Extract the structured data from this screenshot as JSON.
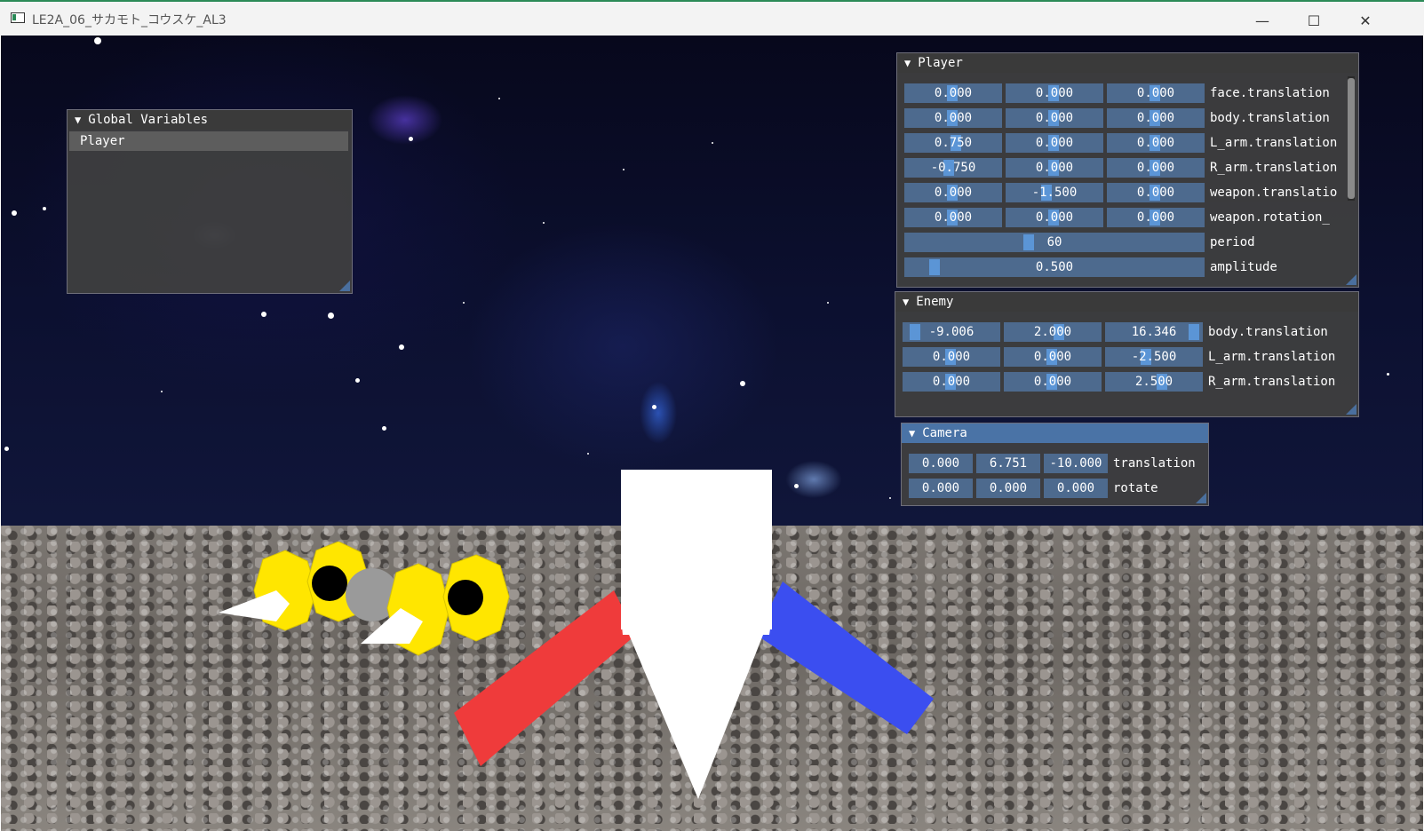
{
  "window": {
    "title": "LE2A_06_サカモト_コウスケ_AL3",
    "min_glyph": "—",
    "max_glyph": "☐",
    "close_glyph": "✕"
  },
  "global_variables": {
    "title": "Global Variables",
    "items": [
      "Player"
    ]
  },
  "player": {
    "title": "Player",
    "rows": [
      {
        "values": [
          "0.000",
          "0.000",
          "0.000"
        ],
        "label": "face.translation"
      },
      {
        "values": [
          "0.000",
          "0.000",
          "0.000"
        ],
        "label": "body.translation"
      },
      {
        "values": [
          "0.750",
          "0.000",
          "0.000"
        ],
        "label": "L_arm.translation"
      },
      {
        "values": [
          "-0.750",
          "0.000",
          "0.000"
        ],
        "label": "R_arm.translation"
      },
      {
        "values": [
          "0.000",
          "-1.500",
          "0.000"
        ],
        "label": "weapon.translatio"
      },
      {
        "values": [
          "0.000",
          "0.000",
          "0.000"
        ],
        "label": "weapon.rotation_"
      }
    ],
    "period": {
      "value": "60",
      "label": "period"
    },
    "amplitude": {
      "value": "0.500",
      "label": "amplitude"
    }
  },
  "enemy": {
    "title": "Enemy",
    "rows": [
      {
        "values": [
          "-9.006",
          "2.000",
          "16.346"
        ],
        "label": "body.translation"
      },
      {
        "values": [
          "0.000",
          "0.000",
          "-2.500"
        ],
        "label": "L_arm.translation"
      },
      {
        "values": [
          "0.000",
          "0.000",
          "2.500"
        ],
        "label": "R_arm.translation"
      }
    ]
  },
  "camera": {
    "title": "Camera",
    "rows": [
      {
        "values": [
          "0.000",
          "6.751",
          "-10.000"
        ],
        "label": "translation"
      },
      {
        "values": [
          "0.000",
          "0.000",
          "0.000"
        ],
        "label": "rotate"
      }
    ]
  },
  "colors": {
    "accent": "#4a73a6",
    "field": "#4d6a8e",
    "slider_grab": "#5b95d6",
    "player_left_arm": "#ef3b3b",
    "player_right_arm": "#3b4ef0",
    "enemy": "#ffe600"
  }
}
